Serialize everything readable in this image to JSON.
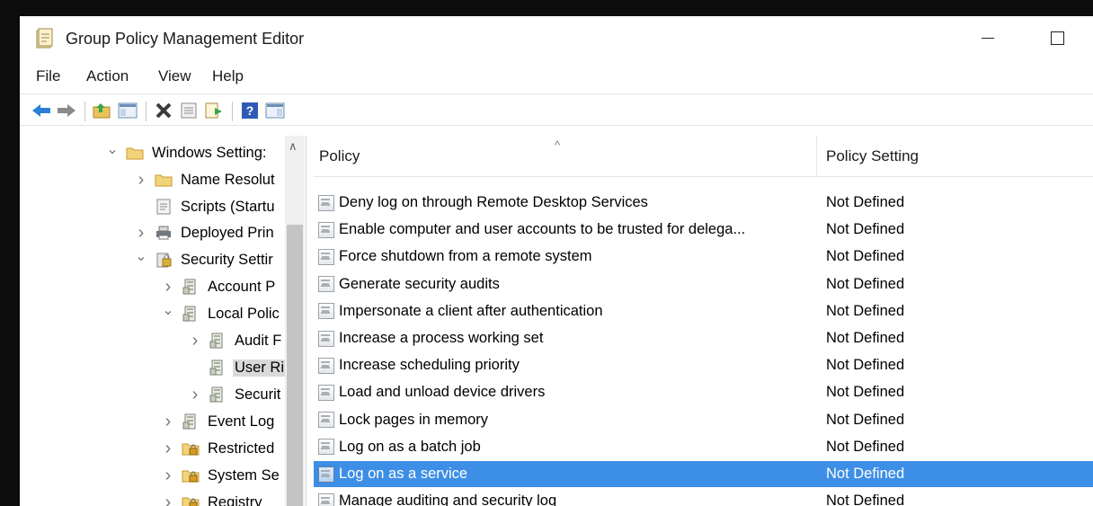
{
  "window": {
    "title": "Group Policy Management Editor"
  },
  "menu": [
    "File",
    "Action",
    "View",
    "Help"
  ],
  "toolbar": {
    "icons": [
      "back-arrow-icon",
      "forward-arrow-icon",
      "up-folder-icon",
      "show-hide-tree-icon",
      "delete-icon",
      "properties-icon",
      "export-list-icon",
      "help-icon",
      "action-pane-icon"
    ]
  },
  "tree": {
    "items": [
      {
        "label": "Windows Setting: ",
        "icon": "folder",
        "expanded": true
      },
      {
        "label": "Name Resolut",
        "icon": "folder",
        "expanded": false
      },
      {
        "label": "Scripts (Startu",
        "icon": "script",
        "expanded": null
      },
      {
        "label": "Deployed Prin",
        "icon": "printer",
        "expanded": false
      },
      {
        "label": "Security Settir",
        "icon": "security",
        "expanded": true
      },
      {
        "label": "Account P",
        "icon": "policy",
        "expanded": false
      },
      {
        "label": "Local Polic",
        "icon": "policy",
        "expanded": true
      },
      {
        "label": "Audit F",
        "icon": "policy",
        "expanded": false
      },
      {
        "label": "User Ri",
        "icon": "policy",
        "expanded": null,
        "selected": true
      },
      {
        "label": "Securit",
        "icon": "policy",
        "expanded": false
      },
      {
        "label": "Event Log",
        "icon": "policy",
        "expanded": false
      },
      {
        "label": "Restricted",
        "icon": "lock-folder",
        "expanded": false
      },
      {
        "label": "System Se",
        "icon": "lock-folder",
        "expanded": false
      },
      {
        "label": "Registry",
        "icon": "lock-folder",
        "expanded": false
      }
    ]
  },
  "list": {
    "columns": {
      "policy": "Policy",
      "setting": "Policy Setting"
    },
    "rows": [
      {
        "policy": "Deny log on through Remote Desktop Services",
        "setting": "Not Defined"
      },
      {
        "policy": "Enable computer and user accounts to be trusted for delega...",
        "setting": "Not Defined"
      },
      {
        "policy": "Force shutdown from a remote system",
        "setting": "Not Defined"
      },
      {
        "policy": "Generate security audits",
        "setting": "Not Defined"
      },
      {
        "policy": "Impersonate a client after authentication",
        "setting": "Not Defined"
      },
      {
        "policy": "Increase a process working set",
        "setting": "Not Defined"
      },
      {
        "policy": "Increase scheduling priority",
        "setting": "Not Defined"
      },
      {
        "policy": "Load and unload device drivers",
        "setting": "Not Defined"
      },
      {
        "policy": "Lock pages in memory",
        "setting": "Not Defined"
      },
      {
        "policy": "Log on as a batch job",
        "setting": "Not Defined"
      },
      {
        "policy": "Log on as a service",
        "setting": "Not Defined",
        "selected": true
      },
      {
        "policy": "Manage auditing and security log",
        "setting": "Not Defined"
      }
    ]
  },
  "colors": {
    "selection": "#3d8ee6",
    "tree_selection": "#d9d9d9"
  }
}
